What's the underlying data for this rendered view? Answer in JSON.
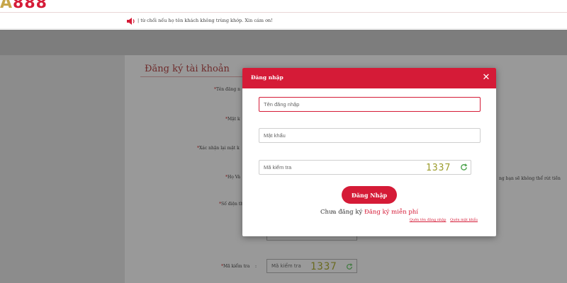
{
  "brand": {
    "logo_text_1": "A",
    "logo_text_2": "888",
    "accent_color": "#d51b37"
  },
  "marquee": {
    "icon": "speaker-icon",
    "text": "| từ chối nếu họ tên khách không trùng khớp. Xin cám ơn!"
  },
  "registration": {
    "title": "Đăng ký tài khoản",
    "labels": {
      "username": "Tên đăng n",
      "password": "Mật k",
      "confirm_password": "Xác nhận lại mật k",
      "full_name": "Họ Và",
      "phone": "Số điện th",
      "blank": "",
      "captcha": "Mã kiểm tra"
    },
    "full_name_hint": "ng bạn sẽ không thể rút tiền",
    "captcha_colon": ":",
    "captcha_placeholder": "Mã kiểm tra",
    "captcha_code": "1337"
  },
  "login_modal": {
    "title": "Đăng nhập",
    "close_icon": "close-icon",
    "username_placeholder": "Tên đăng nhập",
    "password_placeholder": "Mật khẩu",
    "captcha_placeholder": "Mã kiểm tra",
    "captcha_code": "1337",
    "login_button": "Đăng Nhập",
    "no_account_text": "Chưa đăng ký",
    "register_link": "Đăng ký miễn phí",
    "forgot_username": "Quên tên đăng nhập",
    "forgot_password": "Quên mật khẩu"
  }
}
